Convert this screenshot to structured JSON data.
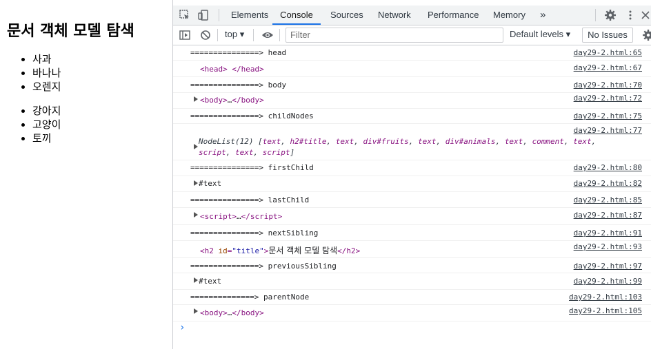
{
  "page": {
    "title": "문서 객체 모델 탐색",
    "fruits": [
      "사과",
      "바나나",
      "오렌지"
    ],
    "animals": [
      "강아지",
      "고양이",
      "토끼"
    ]
  },
  "devtools": {
    "tabs": [
      "Elements",
      "Console",
      "Sources",
      "Network",
      "Performance",
      "Memory"
    ],
    "more": "»",
    "context": "top",
    "filter_placeholder": "Filter",
    "levels": "Default levels",
    "issues": "No Issues",
    "accent_color": "#1a73e8"
  },
  "console": [
    {
      "kind": "sep",
      "text": "===============> head",
      "src": "day29-2.html:65"
    },
    {
      "kind": "head",
      "src": "day29-2.html:67"
    },
    {
      "kind": "sep",
      "text": "===============> body",
      "src": "day29-2.html:70"
    },
    {
      "kind": "body",
      "src": "day29-2.html:72"
    },
    {
      "kind": "sep",
      "text": "===============> childNodes",
      "src": "day29-2.html:75"
    },
    {
      "kind": "nodelist",
      "src": "day29-2.html:77",
      "label": "NodeList(12)",
      "items": [
        "text",
        "h2#title",
        "text",
        "div#fruits",
        "text",
        "div#animals",
        "text",
        "comment",
        "text",
        "script",
        "text",
        "script"
      ]
    },
    {
      "kind": "sep",
      "text": "===============> firstChild",
      "src": "day29-2.html:80"
    },
    {
      "kind": "text",
      "text": "#text",
      "src": "day29-2.html:82"
    },
    {
      "kind": "sep",
      "text": "===============> lastChild",
      "src": "day29-2.html:85"
    },
    {
      "kind": "script",
      "src": "day29-2.html:87"
    },
    {
      "kind": "sep",
      "text": "===============> nextSibling",
      "src": "day29-2.html:91"
    },
    {
      "kind": "h2",
      "src": "day29-2.html:93",
      "attr": "id",
      "value": "\"title\"",
      "inner": "문서 객체 모델 탐색"
    },
    {
      "kind": "sep",
      "text": "===============> previousSibling",
      "src": "day29-2.html:97"
    },
    {
      "kind": "text",
      "text": "#text",
      "src": "day29-2.html:99"
    },
    {
      "kind": "sep",
      "text": "==============> parentNode",
      "src": "day29-2.html:103"
    },
    {
      "kind": "body",
      "src": "day29-2.html:105"
    }
  ]
}
